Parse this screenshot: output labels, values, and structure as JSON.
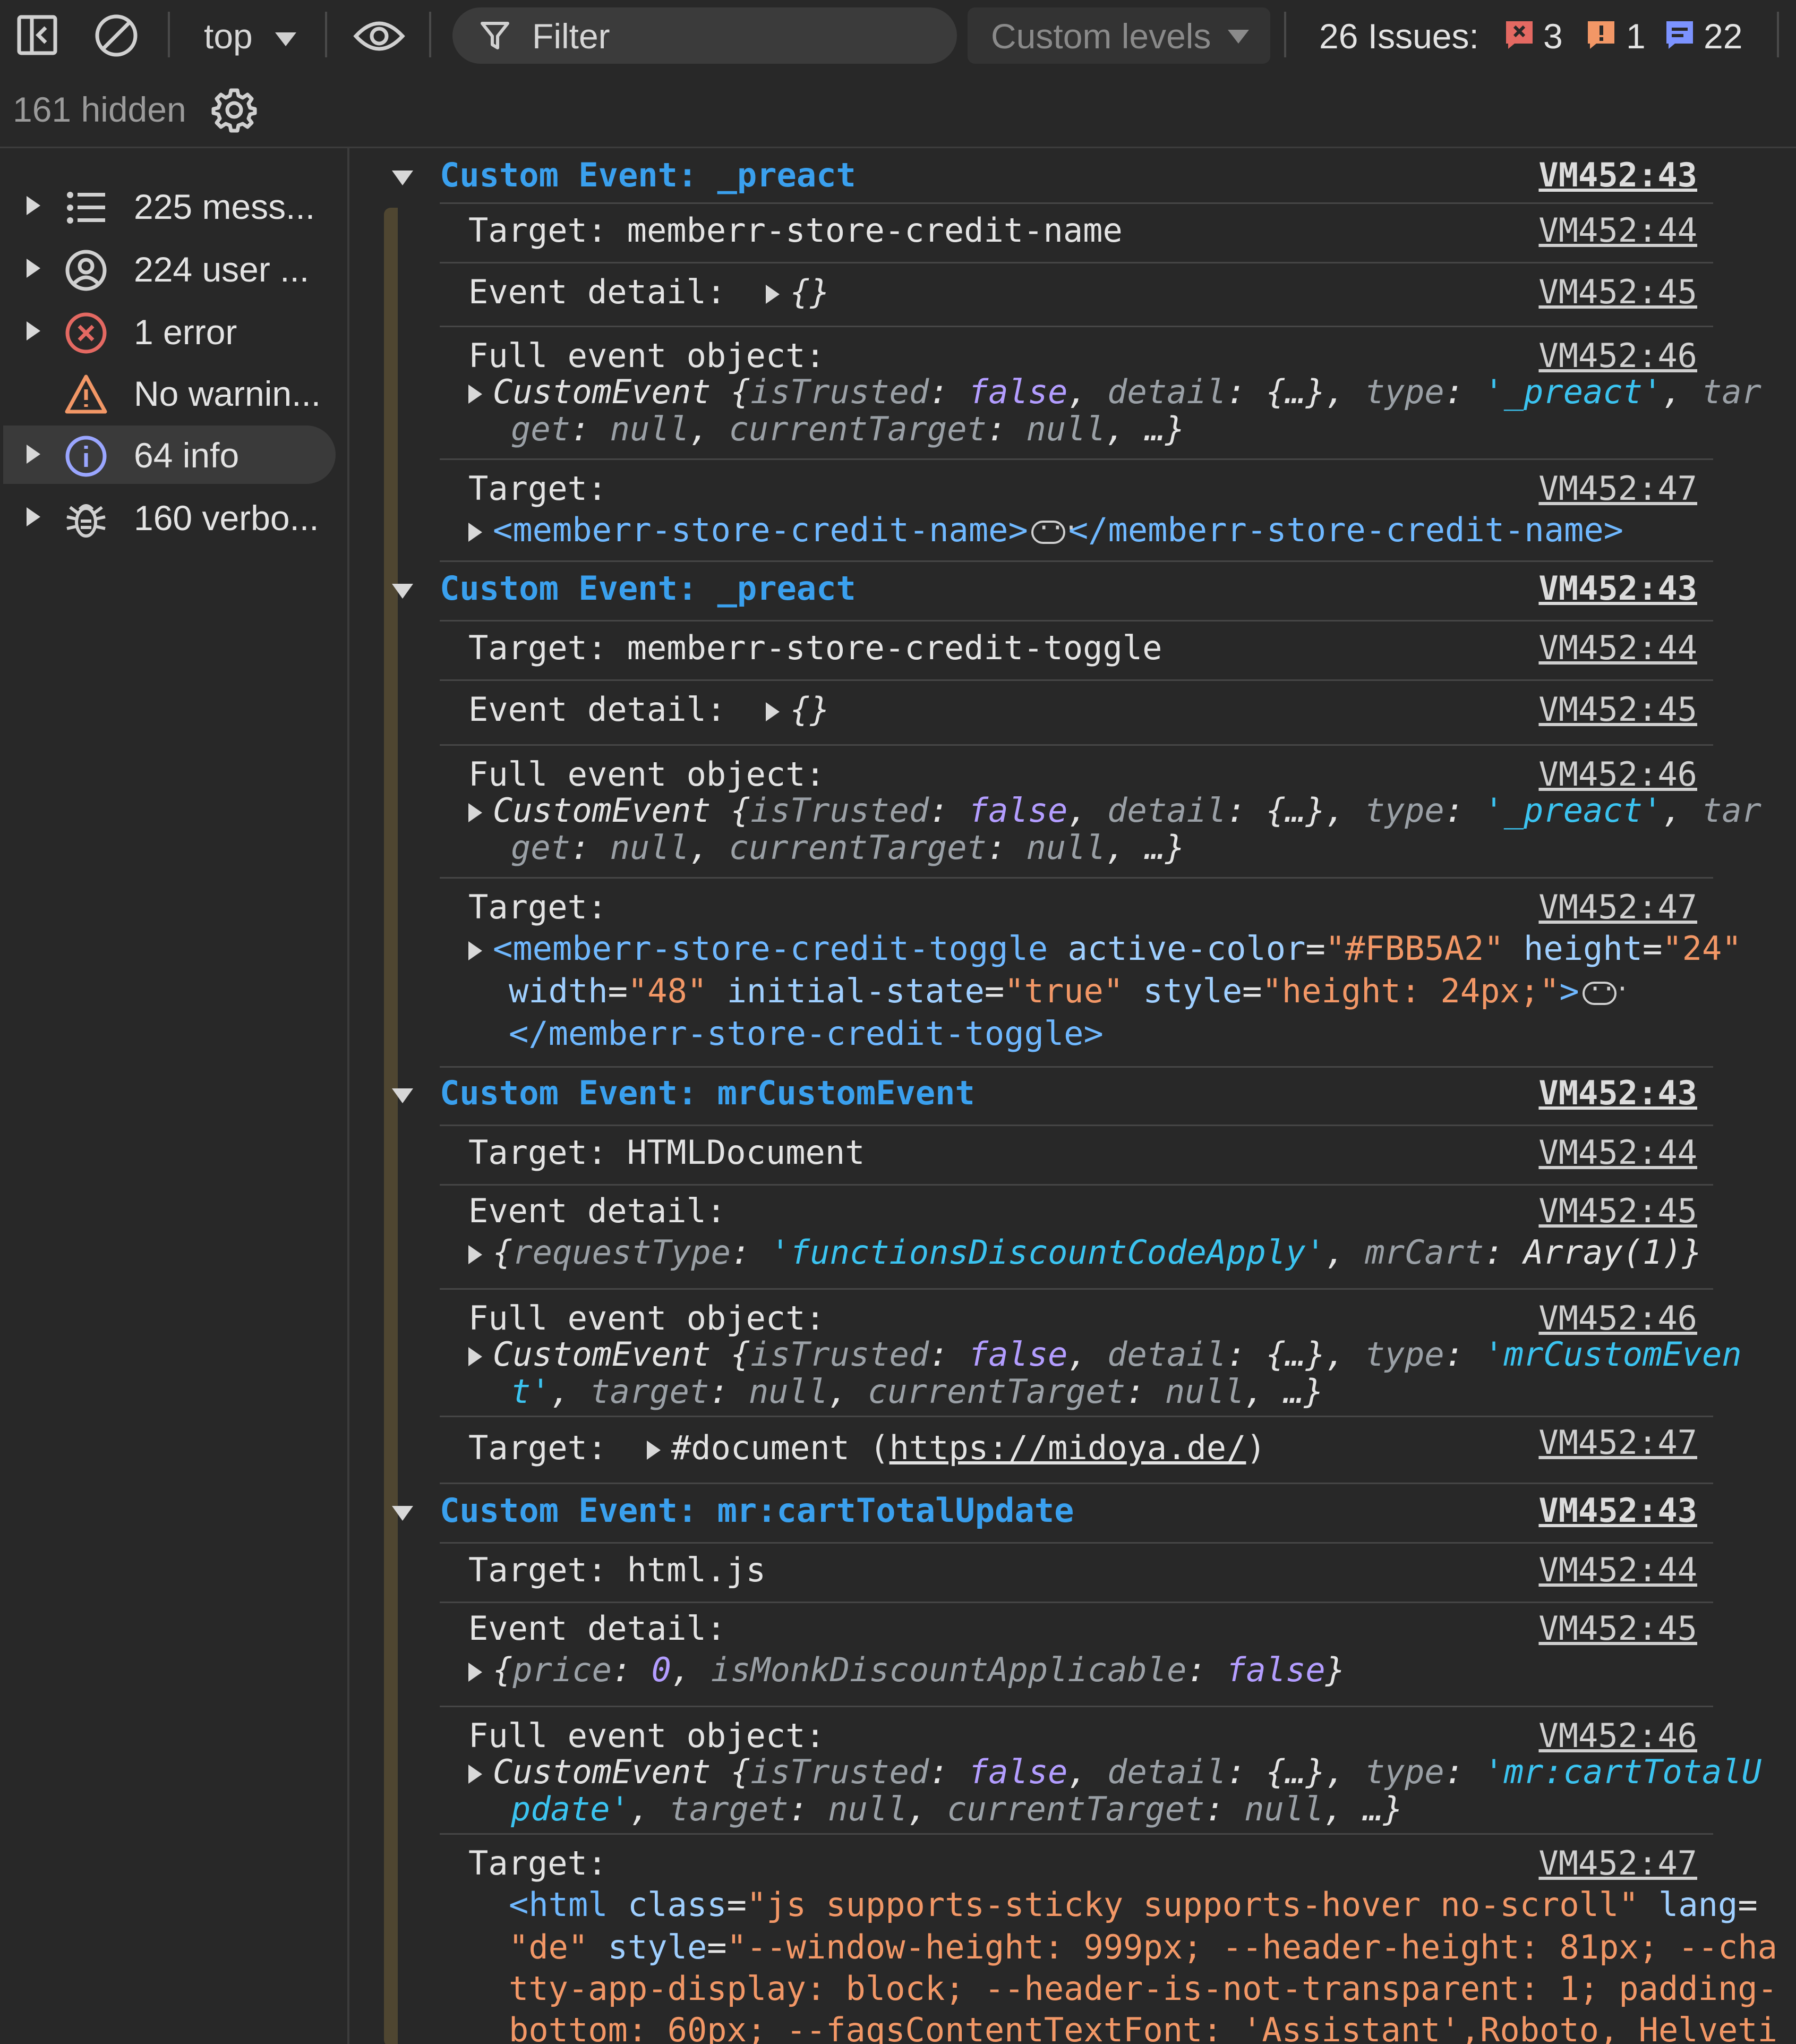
{
  "toolbar": {
    "context": "top",
    "filter_placeholder": "Filter",
    "levels": "Custom levels",
    "issues_label": "26 Issues:",
    "issues_errors": "3",
    "issues_warnings": "1",
    "issues_info": "22",
    "hidden": "161 hidden"
  },
  "sidebar": {
    "items": [
      {
        "label": "225 mess...",
        "icon": "list-icon"
      },
      {
        "label": "224 user ...",
        "icon": "user-icon"
      },
      {
        "label": "1 error",
        "icon": "error-icon"
      },
      {
        "label": "No warnin...",
        "icon": "warning-icon"
      },
      {
        "label": "64 info",
        "icon": "info-icon"
      },
      {
        "label": "160 verbo...",
        "icon": "bug-icon"
      }
    ]
  },
  "colors": {
    "accent": "#3aa0ee",
    "error": "#e46962",
    "warning": "#f29766",
    "info": "#9aa6ff"
  },
  "groups": [
    {
      "title": "Custom Event: _preact",
      "link": "VM452:43",
      "target_text": "Target: memberr-store-credit-name",
      "target_link": "VM452:44",
      "detail_label": "Event detail:",
      "detail_value": "{}",
      "detail_link": "VM452:45",
      "full_label": "Full event object:",
      "full_link": "VM452:46",
      "obj_type": "'_preact'",
      "target2_label": "Target:",
      "target2_link": "VM452:47",
      "element_open": "<memberr-store-credit-name>",
      "element_close": "</memberr-store-credit-name>"
    },
    {
      "title": "Custom Event: _preact",
      "link": "VM452:43",
      "target_text": "Target: memberr-store-credit-toggle",
      "target_link": "VM452:44",
      "detail_label": "Event detail:",
      "detail_value": "{}",
      "detail_link": "VM452:45",
      "full_label": "Full event object:",
      "full_link": "VM452:46",
      "obj_type": "'_preact'",
      "target2_label": "Target:",
      "target2_link": "VM452:47",
      "element_tag": "<memberr-store-credit-toggle",
      "attr_active_color": "#FBB5A2",
      "attr_height": "24",
      "attr_width": "48",
      "attr_initial_state": "true",
      "attr_style": "height: 24px;",
      "element_close": "</memberr-store-credit-toggle>"
    },
    {
      "title": "Custom Event: mrCustomEvent",
      "link": "VM452:43",
      "target_text": "Target: HTMLDocument",
      "target_link": "VM452:44",
      "detail_label": "Event detail:",
      "detail_link": "VM452:45",
      "detail_request_type": "'functionsDiscountCodeApply'",
      "detail_mrcart": "Array(1)",
      "full_label": "Full event object:",
      "full_link": "VM452:46",
      "obj_type_a": "'mrCustomEven",
      "obj_type_b": "t'",
      "target2_label": "Target:",
      "target2_link": "VM452:47",
      "document_node": "#document",
      "document_url": "https://midoya.de/"
    },
    {
      "title": "Custom Event: mr:cartTotalUpdate",
      "link": "VM452:43",
      "target_text": "Target: html.js",
      "target_link": "VM452:44",
      "detail_label": "Event detail:",
      "detail_link": "VM452:45",
      "detail_price": "0",
      "detail_monk": "false",
      "full_label": "Full event object:",
      "full_link": "VM452:46",
      "obj_type_a": "'mr:cartTotalU",
      "obj_type_b": "pdate'",
      "target2_label": "Target:",
      "target2_link": "VM452:47",
      "html_class": "js supports-sticky supports-hover no-scroll",
      "html_lang": "de",
      "html_style_1": "--window-height: 999px; --header-height: 81px; --cha",
      "html_style_2": "tty-app-display: block; --header-is-not-transparent: 1; padding-",
      "html_style_3": "bottom: 60px; --faqsContentTextFont: 'Assistant',Roboto, Helveti"
    }
  ]
}
